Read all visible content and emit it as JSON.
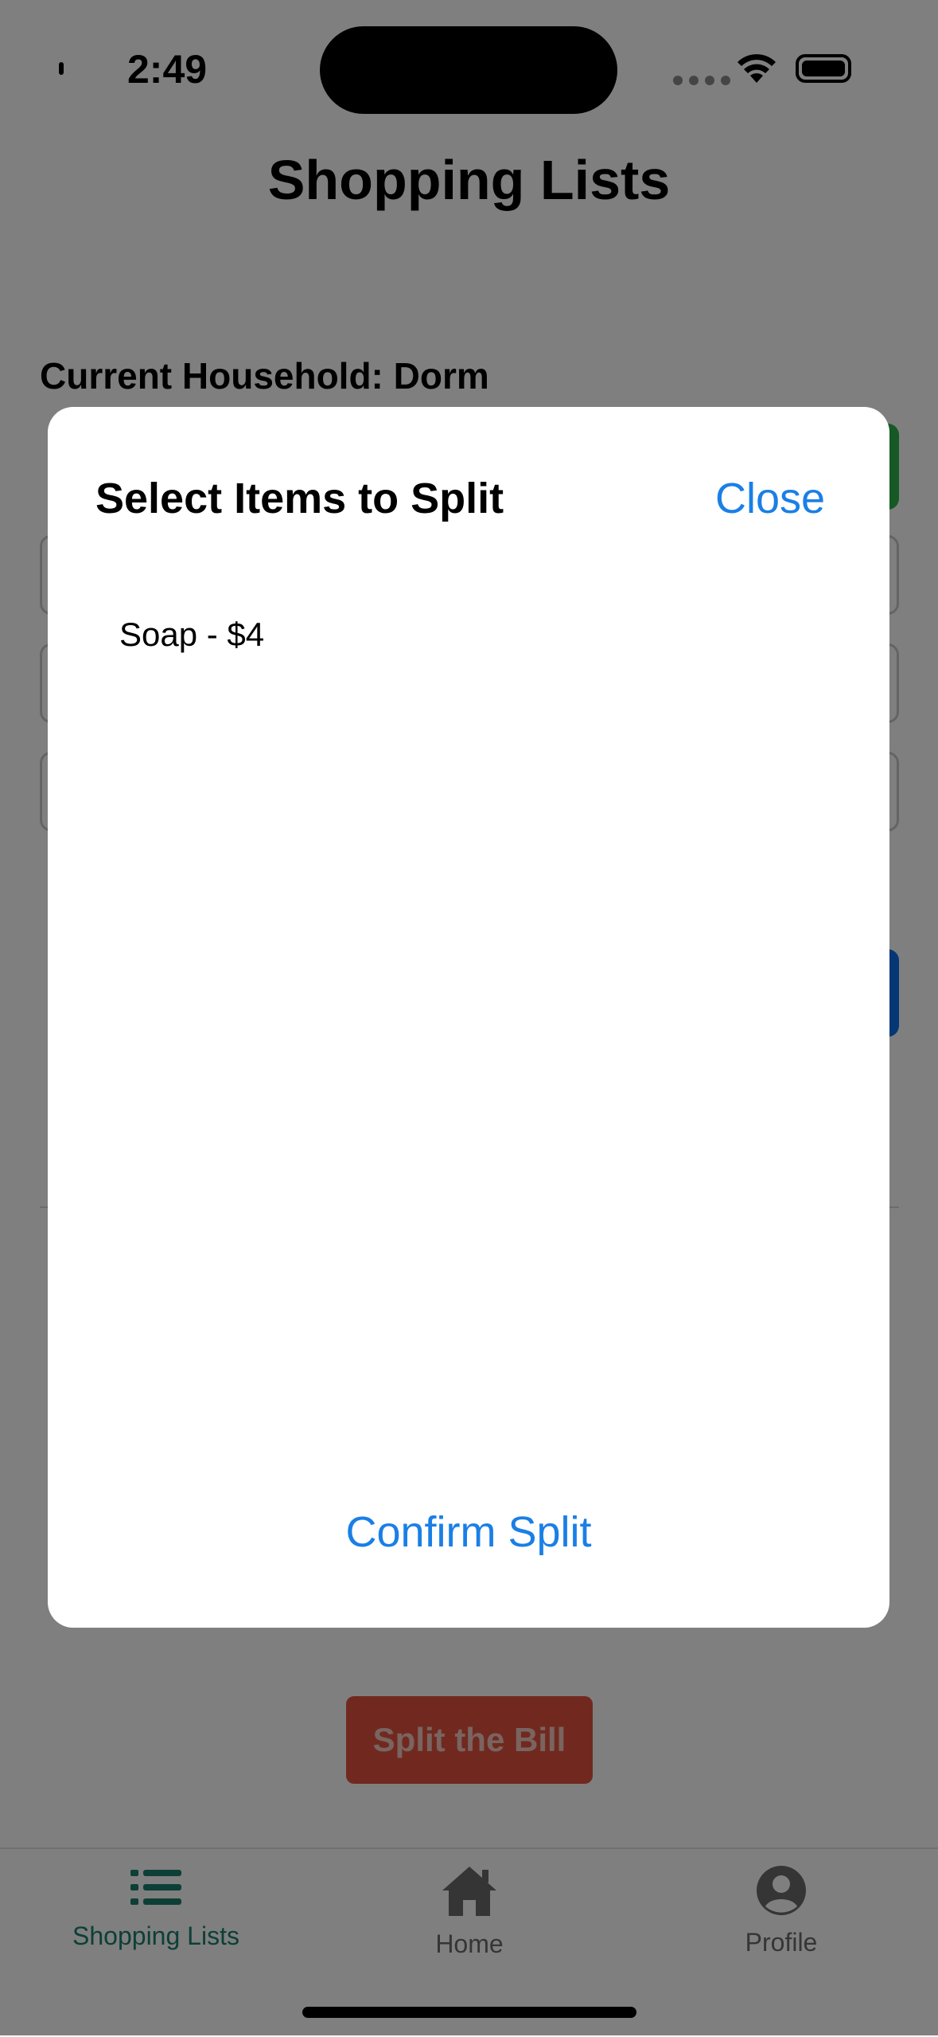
{
  "status_bar": {
    "time": "2:49"
  },
  "screen": {
    "title": "Shopping Lists",
    "household_label": "Current Household: Dorm",
    "split_button_label": "Split the Bill"
  },
  "modal": {
    "title": "Select Items to Split",
    "close_label": "Close",
    "items": [
      {
        "label": "Soap - $4"
      }
    ],
    "confirm_label": "Confirm Split"
  },
  "tab_bar": {
    "tabs": [
      {
        "label": "Shopping Lists",
        "icon": "list-icon",
        "active": true
      },
      {
        "label": "Home",
        "icon": "home-icon",
        "active": false
      },
      {
        "label": "Profile",
        "icon": "profile-icon",
        "active": false
      }
    ]
  },
  "colors": {
    "accent_blue": "#1a7fe6",
    "active_tab": "#1a7f6e",
    "split_button": "#e2533f",
    "add_button": "#2db24b"
  }
}
